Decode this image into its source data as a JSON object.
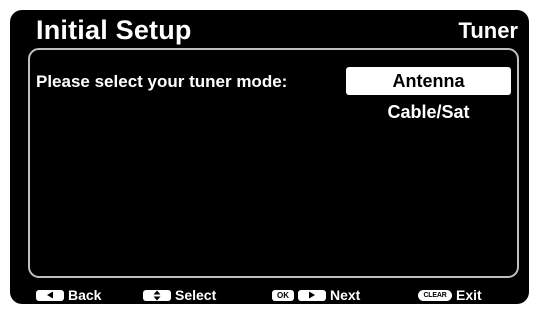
{
  "header": {
    "title": "Initial Setup",
    "section": "Tuner"
  },
  "main": {
    "prompt": "Please select your tuner mode:",
    "options": [
      {
        "label": "Antenna",
        "selected": true
      },
      {
        "label": "Cable/Sat",
        "selected": false
      }
    ]
  },
  "footer": {
    "back_label": "Back",
    "select_label": "Select",
    "ok_key": "OK",
    "next_label": "Next",
    "clear_key": "CLEAR",
    "exit_label": "Exit"
  },
  "icons": {
    "back": "left-arrow-icon",
    "select": "up-down-arrow-icon",
    "next": "right-arrow-icon"
  },
  "colors": {
    "background": "#000000",
    "text": "#ffffff",
    "selection": "#ffffff",
    "panel_border": "#bfbfbf"
  }
}
